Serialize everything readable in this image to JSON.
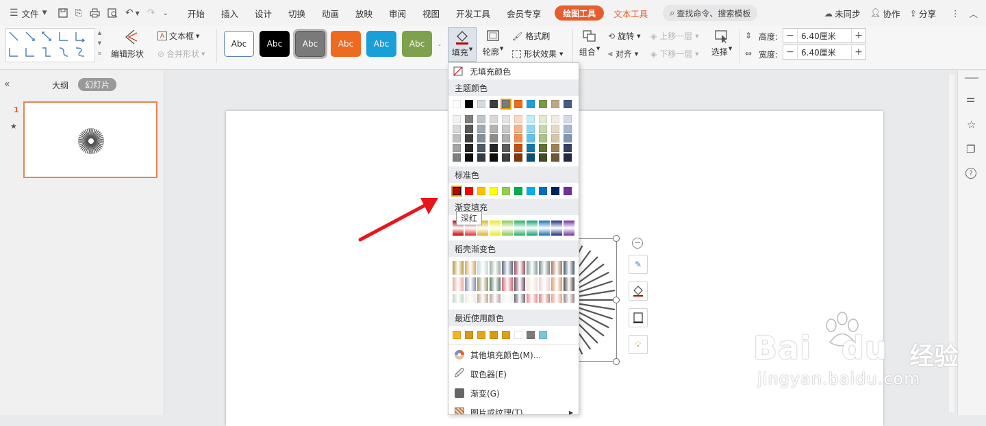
{
  "menubar": {
    "file_label": "文件",
    "tabs": [
      "开始",
      "插入",
      "设计",
      "切换",
      "动画",
      "放映",
      "审阅",
      "视图",
      "开发工具",
      "会员专享"
    ],
    "active_tab": "绘图工具",
    "secondary_tab": "文本工具",
    "search_label": "查找命令、搜索模板",
    "sync_label": "未同步",
    "collab_label": "协作",
    "share_label": "分享"
  },
  "ribbon": {
    "edit_shape": "编辑形状",
    "text_box": "文本框",
    "merge_shape": "合并形状",
    "style_swatches": [
      {
        "label": "Abc",
        "bg": "#ffffff",
        "fg": "#222222",
        "border": "#5b7fb8"
      },
      {
        "label": "Abc",
        "bg": "#000000",
        "fg": "#ffffff",
        "border": "#000000"
      },
      {
        "label": "Abc",
        "bg": "#7a7a7a",
        "fg": "#ffffff",
        "border": "#555555"
      },
      {
        "label": "Abc",
        "bg": "#ee6a1f",
        "fg": "#ffffff",
        "border": "#ee6a1f"
      },
      {
        "label": "Abc",
        "bg": "#1aa0d8",
        "fg": "#ffffff",
        "border": "#1aa0d8"
      },
      {
        "label": "Abc",
        "bg": "#7ea14c",
        "fg": "#ffffff",
        "border": "#7ea14c"
      }
    ],
    "fill": "填充",
    "outline": "轮廓",
    "format_painter": "格式刷",
    "shape_effect": "形状效果",
    "group": "组合",
    "rotate": "旋转",
    "align": "对齐",
    "bring_forward": "上移一层",
    "send_backward": "下移一层",
    "select": "选择",
    "height_label": "高度:",
    "height_value": "6.40厘米",
    "width_label": "宽度:",
    "width_value": "6.40厘米"
  },
  "left_panel": {
    "outline_tab": "大纲",
    "slides_tab": "幻灯片",
    "slide_number": "1"
  },
  "fill_menu": {
    "no_fill": "无填充颜色",
    "theme_colors_title": "主题颜色",
    "theme_top": [
      "#ffffff",
      "#000000",
      "#d3dadf",
      "#3d3d3d",
      "#7b7b7b",
      "#f06a18",
      "#1da1d9",
      "#7a9a45",
      "#bca885",
      "#475a83"
    ],
    "theme_shades": [
      [
        "#f2f2f2",
        "#7f7f7f",
        "#bdc6cd",
        "#d9d9d9",
        "#e4e4e4",
        "#fcd9c2",
        "#c3ebfb",
        "#e2ecd5",
        "#f1ece3",
        "#d5dbe7"
      ],
      [
        "#d9d9d9",
        "#595959",
        "#9fabb4",
        "#b3b3b3",
        "#cacaca",
        "#f9b388",
        "#8fd7f6",
        "#c6d9ac",
        "#e3d9c7",
        "#abb8cf"
      ],
      [
        "#bfbfbf",
        "#3f3f3f",
        "#80909c",
        "#8c8c8c",
        "#afafaf",
        "#f68e4f",
        "#5ac3f1",
        "#a9c682",
        "#d5c6ab",
        "#8195b7"
      ],
      [
        "#a5a5a5",
        "#262626",
        "#4c5a65",
        "#262626",
        "#5c5c5c",
        "#c5500d",
        "#1079a9",
        "#5c7334",
        "#9c8254",
        "#34425f"
      ],
      [
        "#7f7f7f",
        "#0d0d0d",
        "#333c43",
        "#0d0d0d",
        "#3d3d3d",
        "#833508",
        "#0a5070",
        "#3d4c22",
        "#685738",
        "#222c3f"
      ]
    ],
    "standard_title": "标准色",
    "standard_colors": [
      "#c00000",
      "#ff0000",
      "#ffc000",
      "#ffff00",
      "#92d050",
      "#00b050",
      "#00b0f0",
      "#0070c0",
      "#002060",
      "#7030a0"
    ],
    "gradient_title": "渐变填充",
    "gradient_colors": [
      "#c00000",
      "#e03030",
      "#e0b030",
      "#e8e820",
      "#8cc84c",
      "#20b060",
      "#10a070",
      "#1070c0",
      "#1c2c80",
      "#7030a0"
    ],
    "docer_title": "稻壳渐变色",
    "docer_rows": [
      [
        "#b8983c",
        "#d4a860",
        "#c8d8d8",
        "#98a898",
        "#606880",
        "#985060",
        "#80a098",
        "#788888",
        "#a87860",
        "#405868"
      ],
      [
        "#e8a8a0",
        "#8890b0",
        "#989868",
        "#587868",
        "#d06878",
        "#705060",
        "#f0e0d0",
        "#f0d0d8",
        "#d8a070",
        "#504840"
      ],
      [
        "#c0d8c0",
        "#f0e8e0",
        "#c0a898",
        "#b8a0a0",
        "#f0f0f0",
        "#686870",
        "#e88890",
        "#d88080",
        "#e8a090",
        "#988080"
      ]
    ],
    "recent_title": "最近使用颜色",
    "recent_colors": [
      "#f2b720",
      "#d69a18",
      "#e0a818",
      "#d89a10",
      "#e0a010",
      "#ffffff",
      "#7b7b7b",
      "#7ac4e0"
    ],
    "more_fill": "其他填充颜色(M)...",
    "eyedropper": "取色器(E)",
    "gradient_item": "渐变(G)",
    "picture_texture": "图片或纹理(T)",
    "tooltip": "深红"
  },
  "watermark": {
    "brand": "Bai",
    "brand2": "du",
    "cn": "经验",
    "url": "jingyan.baidu.com"
  }
}
